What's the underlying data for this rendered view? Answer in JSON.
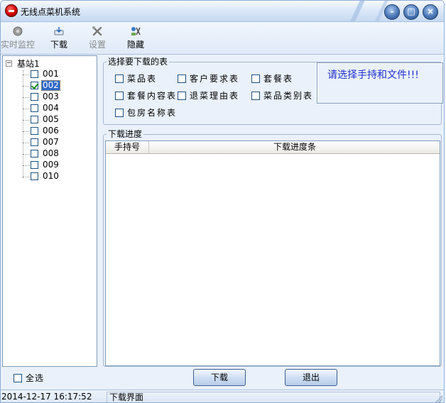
{
  "window": {
    "title": "无线点菜机系统",
    "controls": [
      "minimize-icon",
      "maximize-icon",
      "close-icon"
    ]
  },
  "toolbar": {
    "items": [
      {
        "label": "实时监控",
        "icon": "monitor-icon",
        "enabled": false
      },
      {
        "label": "下载",
        "icon": "download-icon",
        "enabled": true
      },
      {
        "label": "设置",
        "icon": "settings-icon",
        "enabled": false
      },
      {
        "label": "隐藏",
        "icon": "hide-icon",
        "enabled": true
      }
    ]
  },
  "tree": {
    "root": {
      "label": "基站1",
      "expander": "⊟"
    },
    "items": [
      {
        "label": "001",
        "checked": false,
        "selected": false
      },
      {
        "label": "002",
        "checked": true,
        "selected": true
      },
      {
        "label": "003",
        "checked": false,
        "selected": false
      },
      {
        "label": "004",
        "checked": false,
        "selected": false
      },
      {
        "label": "005",
        "checked": false,
        "selected": false
      },
      {
        "label": "006",
        "checked": false,
        "selected": false
      },
      {
        "label": "007",
        "checked": false,
        "selected": false
      },
      {
        "label": "008",
        "checked": false,
        "selected": false
      },
      {
        "label": "009",
        "checked": false,
        "selected": false
      },
      {
        "label": "010",
        "checked": false,
        "selected": false
      }
    ]
  },
  "tables_group": {
    "title": "选择要下载的表",
    "options": [
      {
        "label": "菜品表",
        "checked": false
      },
      {
        "label": "客户要求表",
        "checked": false
      },
      {
        "label": "套餐表",
        "checked": false
      },
      {
        "label": "套餐内容表",
        "checked": false
      },
      {
        "label": "退菜理由表",
        "checked": false
      },
      {
        "label": "菜品类别表",
        "checked": false
      },
      {
        "label": "包房名称表",
        "checked": false
      }
    ],
    "hint": "请选择手持和文件!!!"
  },
  "progress_group": {
    "title": "下载进度",
    "columns": [
      "手持号",
      "下载进度条"
    ],
    "rows": []
  },
  "footer": {
    "select_all_label": "全选",
    "select_all_checked": false,
    "download_button": "下载",
    "exit_button": "退出"
  },
  "statusbar": {
    "datetime": "2014-12-17 16:17:52",
    "page": "下载界面"
  },
  "colors": {
    "window_bg": "#eaf1fb",
    "selection": "#316ac5",
    "hint_text": "#1f2fd0"
  }
}
